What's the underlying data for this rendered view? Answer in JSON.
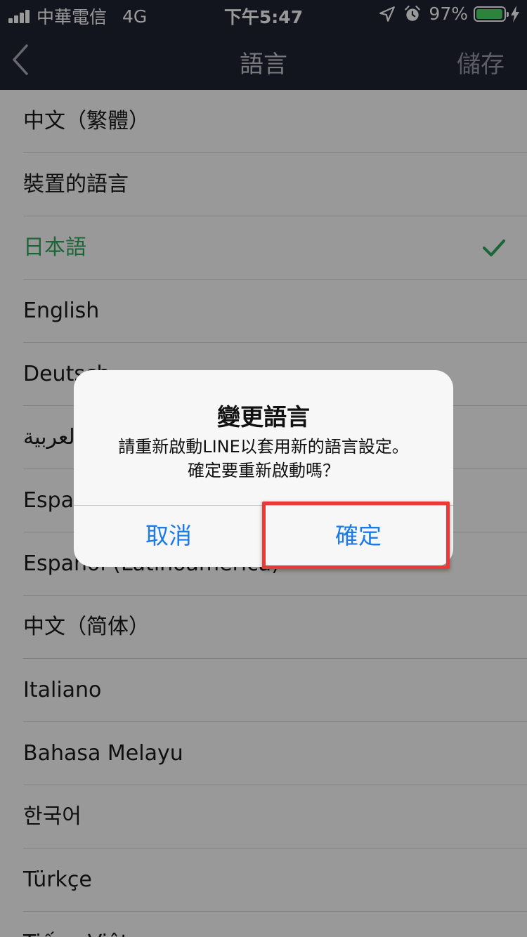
{
  "status_bar": {
    "carrier": "中華電信",
    "network": "4G",
    "time": "下午5:47",
    "battery_percent": "97%",
    "battery_level": 0.97,
    "icons": [
      "signal-icon",
      "location-icon",
      "alarm-icon",
      "battery-icon",
      "charging-bolt-icon"
    ]
  },
  "nav": {
    "title": "語言",
    "save_label": "儲存",
    "back_icon": "chevron-left-icon"
  },
  "languages": [
    "中文（繁體）",
    "裝置的語言",
    "日本語",
    "English",
    "Deutsch",
    "العربية",
    "Español",
    "Español (Latinoamérica)",
    "中文（简体）",
    "Italiano",
    "Bahasa Melayu",
    "한국어",
    "Türkçe",
    "Tiếng Việt"
  ],
  "selected_language": "日本語",
  "colors": {
    "header_bg": "#1e2233",
    "selected": "#2fa85c",
    "link_blue": "#1a7aea",
    "highlight": "#e83a3a"
  },
  "dialog": {
    "title": "變更語言",
    "message_line1": "請重新啟動LINE以套用新的語言設定。",
    "message_line2": "確定要重新啟動嗎？",
    "cancel_label": "取消",
    "confirm_label": "確定"
  }
}
